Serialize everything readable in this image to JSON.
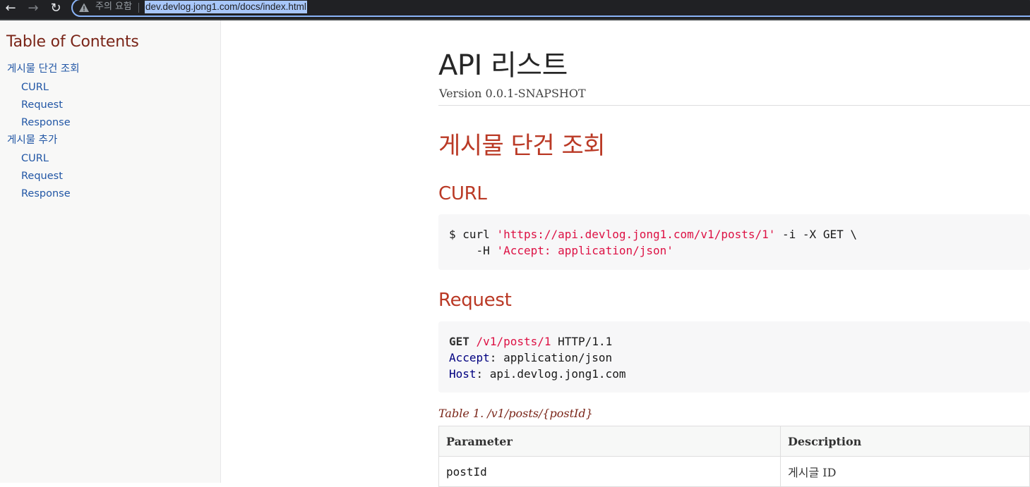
{
  "browser": {
    "security_label": "주의 요함",
    "url": "dev.devlog.jong1.com/docs/index.html",
    "back_icon": "←",
    "forward_icon": "→",
    "reload_icon": "↻",
    "omnibox_border_color": "#8ab4f8"
  },
  "sidebar": {
    "title": "Table of Contents",
    "items": [
      {
        "label": "게시물 단건 조회",
        "level": 1
      },
      {
        "label": "CURL",
        "level": 2
      },
      {
        "label": "Request",
        "level": 2
      },
      {
        "label": "Response",
        "level": 2
      },
      {
        "label": "게시물 추가",
        "level": 1
      },
      {
        "label": "CURL",
        "level": 2
      },
      {
        "label": "Request",
        "level": 2
      },
      {
        "label": "Response",
        "level": 2
      }
    ]
  },
  "main": {
    "title": "API 리스트",
    "version": "Version 0.0.1-SNAPSHOT",
    "section_title": "게시물 단건 조회",
    "curl": {
      "heading": "CURL",
      "line1_prefix": "$ curl ",
      "line1_url": "'https://api.devlog.jong1.com/v1/posts/1'",
      "line1_suffix": " -i -X GET \\",
      "line2_prefix": "    -H ",
      "line2_header": "'Accept: application/json'"
    },
    "request": {
      "heading": "Request",
      "method": "GET",
      "path": "/v1/posts/1",
      "protocol": " HTTP/1.1",
      "header1_name": "Accept",
      "header1_value": ": application/json",
      "header2_name": "Host",
      "header2_value": ": api.devlog.jong1.com"
    },
    "table": {
      "caption": "Table 1. /v1/posts/{postId}",
      "columns": [
        "Parameter",
        "Description"
      ],
      "rows": [
        [
          "postId",
          "게시글 ID"
        ]
      ]
    }
  },
  "colors": {
    "heading": "#ba3925",
    "toc_title": "#7a2518",
    "link": "#2156a5",
    "code_string": "#dd1144",
    "code_header": "#000080"
  }
}
